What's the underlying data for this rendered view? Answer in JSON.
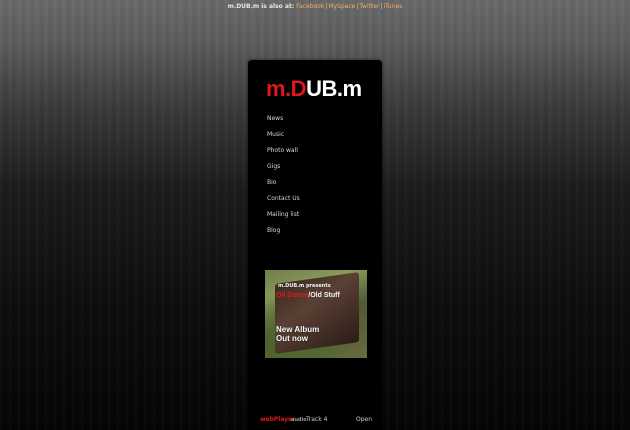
{
  "topbar": {
    "intro": "m.DUB.m is also at:",
    "links": [
      "Facebook",
      "MySpace",
      "Twitter",
      "iTunes"
    ],
    "separator": "|"
  },
  "logo": {
    "red": "m.D",
    "white": "UB.m"
  },
  "nav": {
    "items": [
      "News",
      "Music",
      "Photo wall",
      "Gigs",
      "Bio",
      "Contact Us",
      "Mailing list",
      "Blog"
    ]
  },
  "album": {
    "presents": "m.DUB.m presents",
    "title_red": "Oil Dance",
    "title_white": "/Old Stuff",
    "new_line1": "New Album",
    "new_line2": "Out now"
  },
  "player": {
    "brand": "webPlayer",
    "brand_sub": "audio",
    "track": "Track 4",
    "open": "Open"
  },
  "colors": {
    "accent_red": "#e01818",
    "link_orange": "#f0b06a",
    "panel": "#000000"
  }
}
